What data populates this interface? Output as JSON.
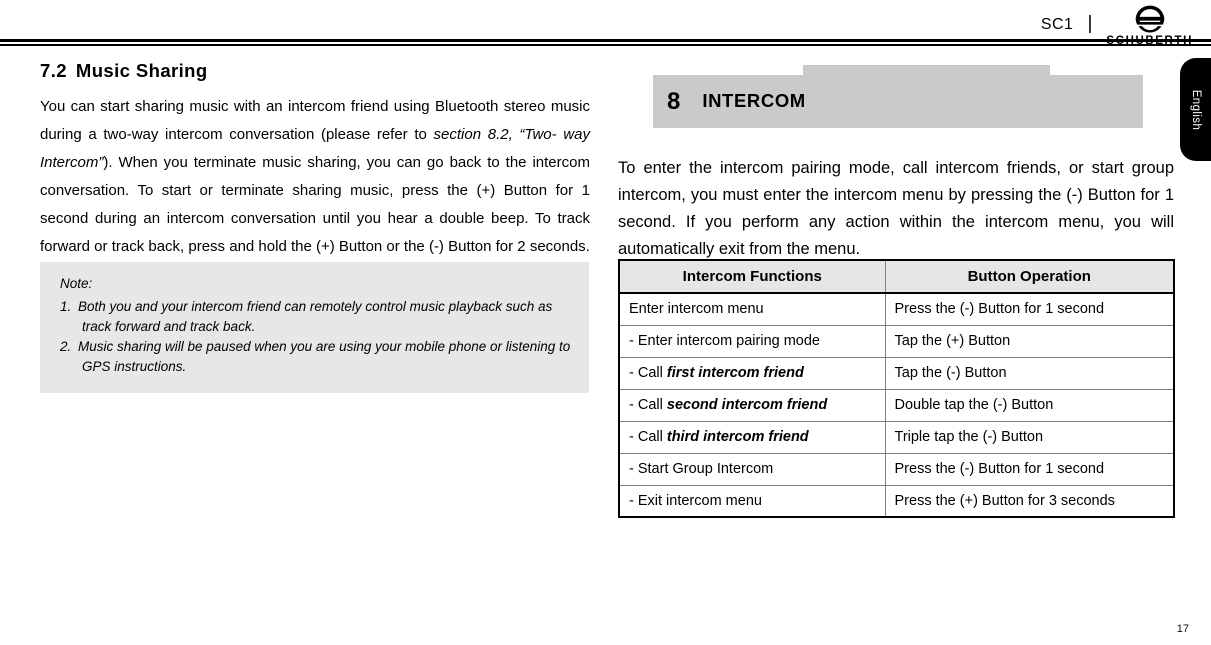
{
  "header": {
    "model": "SC1",
    "separator": "|",
    "brand_name": "SCHUBERTH",
    "logo_icon": "schuberth-helmet-logo"
  },
  "left_column": {
    "section_number": "7.2",
    "section_title": "Music Sharing",
    "paragraph_parts": {
      "p1": "You can start sharing music with an intercom friend using Bluetooth stereo music during a two-way intercom conversation (please refer to ",
      "p2_italic": "section 8.2, “Two- way Intercom”",
      "p3": "). When you terminate music sharing, you can go back to the intercom conversation. To start or terminate sharing music, press the (+) Button for 1 second during an intercom conversation until you hear a double beep. To track forward or track back, press and hold the (+) Button or the (-) Button for 2 seconds."
    },
    "note": {
      "title": "Note:",
      "items": [
        {
          "label": "1.",
          "text": "Both you and your intercom friend can remotely control music playback such as track forward and track back."
        },
        {
          "label": "2.",
          "text": "Music sharing will be paused when you are using your mobile phone or listening to GPS instructions."
        }
      ]
    }
  },
  "right_column": {
    "chapter_number": "8",
    "chapter_title": "INTERCOM",
    "intro": "To enter the intercom pairing mode, call intercom friends, or start group intercom, you must enter the intercom menu by pressing the (-) Button for 1 second. If you perform any action within the intercom menu, you will automatically exit from the menu.",
    "table": {
      "columns": [
        "Intercom Functions",
        "Button Operation"
      ],
      "rows": [
        {
          "function_prefix": "Enter intercom menu",
          "function_emphasis": "",
          "operation": "Press the (-) Button for 1 second"
        },
        {
          "function_prefix": "- Enter intercom pairing mode",
          "function_emphasis": "",
          "operation": "Tap the (+) Button"
        },
        {
          "function_prefix": "- Call ",
          "function_emphasis": "first intercom friend",
          "operation": "Tap the (-) Button"
        },
        {
          "function_prefix": "- Call ",
          "function_emphasis": "second intercom friend",
          "operation": "Double tap the (-) Button"
        },
        {
          "function_prefix": "- Call ",
          "function_emphasis": "third intercom friend",
          "operation": "Triple tap the (-) Button"
        },
        {
          "function_prefix": "- Start Group Intercom",
          "function_emphasis": "",
          "operation": "Press the (-) Button for 1 second"
        },
        {
          "function_prefix": "- Exit intercom menu",
          "function_emphasis": "",
          "operation": "Press the (+) Button for 3 seconds"
        }
      ]
    }
  },
  "language_tab": {
    "label": "English"
  },
  "footer": {
    "page_number": "17"
  },
  "colors": {
    "note_background": "#e7e7e7",
    "chapter_band": "#cacaca",
    "chapter_tab": "#c9c9c9",
    "table_header": "#e6e6e6",
    "table_border": "#000000",
    "table_inner_border": "#808080",
    "language_tab": "#000000"
  }
}
